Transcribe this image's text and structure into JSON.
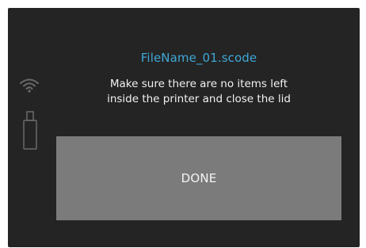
{
  "dialog": {
    "file_name": "FileName_01.scode",
    "message_line1": "Make sure there are no items left",
    "message_line2": "inside the printer and close the lid",
    "done_label": "DONE"
  },
  "status": {
    "wifi_icon": "wifi-icon",
    "usb_icon": "usb-drive-icon"
  },
  "colors": {
    "background": "#242424",
    "accent": "#3ea7d7",
    "text": "#f1f1f1",
    "button": "#7b7b7b",
    "icon": "#6a6a6a"
  }
}
